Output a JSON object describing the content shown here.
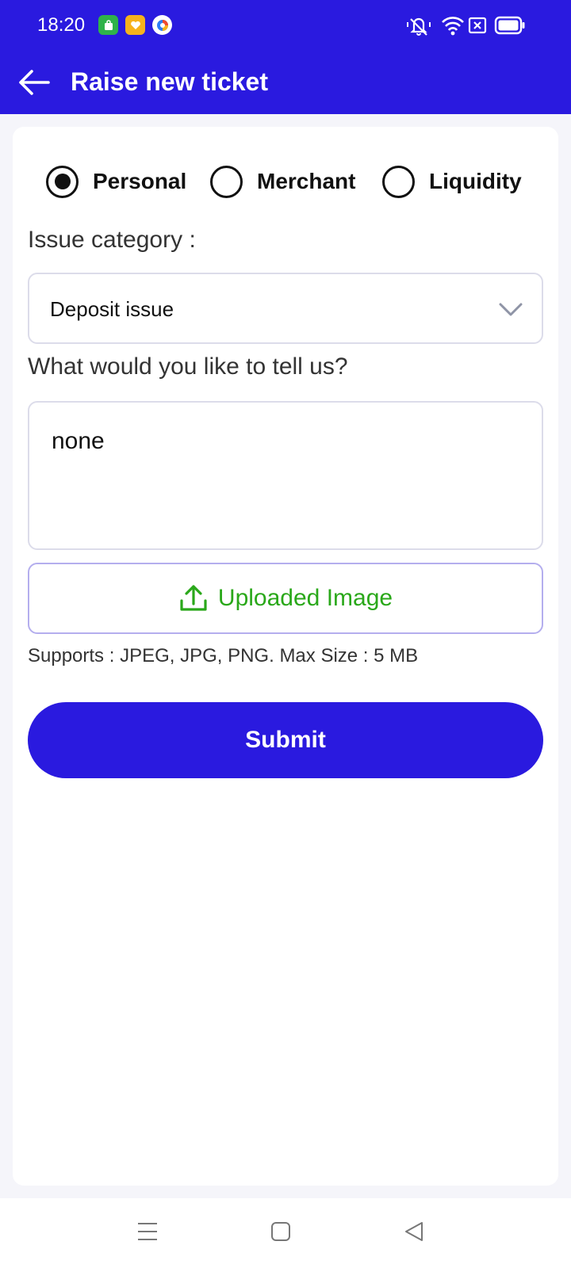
{
  "status_bar": {
    "time": "18:20",
    "app_icons": [
      "store-app-icon",
      "heart-app-icon",
      "browser-app-icon"
    ],
    "indicators": [
      "mute-bell-icon",
      "wifi-icon",
      "sim-icon",
      "battery-icon"
    ]
  },
  "app_bar": {
    "title": "Raise new ticket",
    "back_icon": "arrow-left-icon"
  },
  "form": {
    "account_types": [
      {
        "label": "Personal",
        "selected": true
      },
      {
        "label": "Merchant",
        "selected": false
      },
      {
        "label": "Liquidity",
        "selected": false
      }
    ],
    "issue_category": {
      "label": "Issue category :",
      "value": "Deposit issue",
      "icon": "chevron-down-icon"
    },
    "message": {
      "label": "What would you like to tell us?",
      "value": "none"
    },
    "upload": {
      "label": "Uploaded Image",
      "icon": "upload-icon",
      "hint": "Supports : JPEG, JPG, PNG. Max Size : 5 MB"
    },
    "submit_label": "Submit"
  },
  "nav_bar": {
    "buttons": [
      "menu-icon",
      "home-square-icon",
      "back-triangle-icon"
    ]
  },
  "colors": {
    "primary": "#2a1adf",
    "upload_text": "#2aa81a",
    "background": "#f5f5fa"
  }
}
